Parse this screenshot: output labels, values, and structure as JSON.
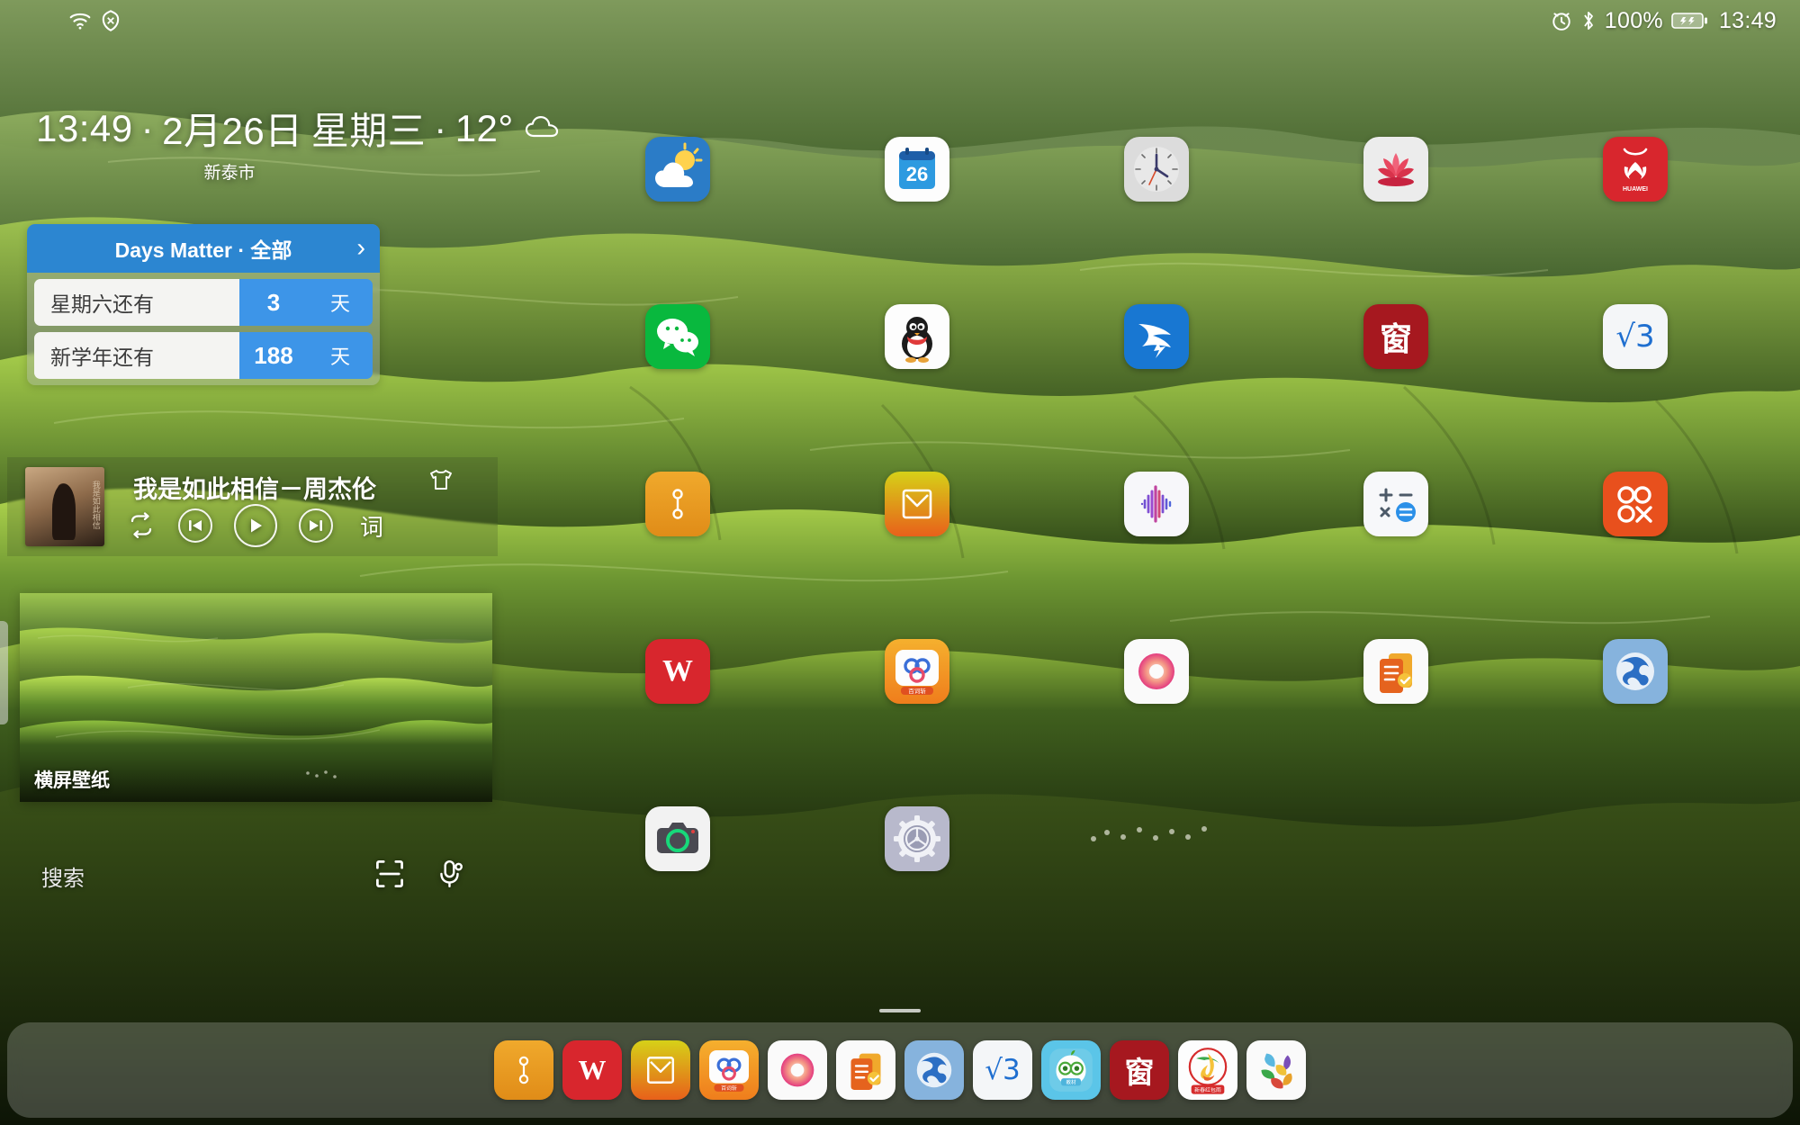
{
  "statusbar": {
    "left_icons": [
      "wifi-icon",
      "vpn-icon"
    ],
    "alarm_icon": "alarm-icon",
    "bluetooth_icon": "bluetooth-icon",
    "battery_percent": "100%",
    "battery_icon": "battery-charging-icon",
    "time": "13:49"
  },
  "clock_widget": {
    "time": "13:49",
    "sep1": "·",
    "date": "2月26日",
    "weekday": "星期三",
    "sep2": "·",
    "temperature": "12°",
    "weather_icon": "cloud-icon",
    "city": "新泰市"
  },
  "days_matter": {
    "title": "Days Matter · 全部",
    "chevron": "›",
    "rows": [
      {
        "label": "星期六还有",
        "count": "3",
        "unit": "天"
      },
      {
        "label": "新学年还有",
        "count": "188",
        "unit": "天"
      }
    ]
  },
  "music": {
    "song_title": "我是如此相信－周杰伦",
    "album_text": "我是如此相信",
    "skin_icon": "tshirt-skin-icon",
    "controls": [
      {
        "name": "repeat-icon",
        "label": ""
      },
      {
        "name": "previous-icon",
        "label": ""
      },
      {
        "name": "play-icon",
        "label": ""
      },
      {
        "name": "next-icon",
        "label": ""
      }
    ],
    "lyrics_label": "词"
  },
  "wallpaper_widget": {
    "label": "横屏壁纸"
  },
  "search": {
    "placeholder": "搜索",
    "scan_icon": "scan-icon",
    "voice_icon": "voice-search-icon"
  },
  "app_grid": {
    "rows": [
      [
        {
          "name": "weather",
          "icon": "weather-icon",
          "label": ""
        },
        {
          "name": "calendar",
          "icon": "calendar-icon",
          "label": "26"
        },
        {
          "name": "clock",
          "icon": "clock-icon",
          "label": ""
        },
        {
          "name": "gallery",
          "icon": "gallery-lotus-icon",
          "label": ""
        },
        {
          "name": "appgallery",
          "icon": "huawei-appgallery-icon",
          "label": "HUAWEI"
        }
      ],
      [
        {
          "name": "wechat",
          "icon": "wechat-icon",
          "label": ""
        },
        {
          "name": "qq",
          "icon": "qq-penguin-icon",
          "label": ""
        },
        {
          "name": "wingapp",
          "icon": "blue-wing-icon",
          "label": ""
        },
        {
          "name": "window-app",
          "icon": "chinese-window-icon",
          "label": "窗"
        },
        {
          "name": "math-app",
          "icon": "sqrt3-icon",
          "label": "√3"
        }
      ],
      [
        {
          "name": "notes-orange",
          "icon": "orange-note-icon",
          "label": ""
        },
        {
          "name": "email",
          "icon": "email-envelope-icon",
          "label": ""
        },
        {
          "name": "recorder",
          "icon": "sound-recorder-icon",
          "label": ""
        },
        {
          "name": "calculator",
          "icon": "calculator-icon",
          "label": ""
        },
        {
          "name": "qq-orange",
          "icon": "orange-qq-icon",
          "label": ""
        }
      ],
      [
        {
          "name": "wps-office",
          "icon": "wps-w-icon",
          "label": "W"
        },
        {
          "name": "baidu-app",
          "icon": "baidu-orange-icon",
          "label": ""
        },
        {
          "name": "music-pink",
          "icon": "pink-music-icon",
          "label": ""
        },
        {
          "name": "memo",
          "icon": "memo-notes-icon",
          "label": ""
        },
        {
          "name": "browser",
          "icon": "globe-browser-icon",
          "label": ""
        }
      ],
      [
        {
          "name": "camera",
          "icon": "camera-icon",
          "label": ""
        },
        {
          "name": "settings",
          "icon": "settings-gear-icon",
          "label": ""
        },
        {
          "name": "empty-3",
          "icon": "",
          "label": ""
        },
        {
          "name": "empty-4",
          "icon": "",
          "label": ""
        },
        {
          "name": "empty-5",
          "icon": "",
          "label": ""
        }
      ]
    ]
  },
  "dock": {
    "items": [
      {
        "name": "notes-orange",
        "icon": "orange-note-icon",
        "label": ""
      },
      {
        "name": "wps-office",
        "icon": "wps-w-icon",
        "label": "W"
      },
      {
        "name": "email",
        "icon": "email-envelope-icon",
        "label": ""
      },
      {
        "name": "baidu-app",
        "icon": "baidu-orange-icon",
        "label": ""
      },
      {
        "name": "music-pink",
        "icon": "pink-music-icon",
        "label": ""
      },
      {
        "name": "memo",
        "icon": "memo-notes-icon",
        "label": ""
      },
      {
        "name": "browser",
        "icon": "globe-browser-icon",
        "label": ""
      },
      {
        "name": "math-app",
        "icon": "sqrt3-icon",
        "label": "√3"
      },
      {
        "name": "apple-edu",
        "icon": "apple-owl-icon",
        "label": ""
      },
      {
        "name": "window-app",
        "icon": "chinese-window-icon",
        "label": "窗"
      },
      {
        "name": "redpacket",
        "icon": "spring-redpacket-icon",
        "label": ""
      },
      {
        "name": "photos-color",
        "icon": "color-petals-icon",
        "label": ""
      }
    ]
  },
  "colors": {
    "accent_blue": "#2c86d1",
    "row_blue": "#3d95e8",
    "wechat_green": "#09b83e",
    "red": "#d0202a",
    "orange": "#e8a022"
  }
}
